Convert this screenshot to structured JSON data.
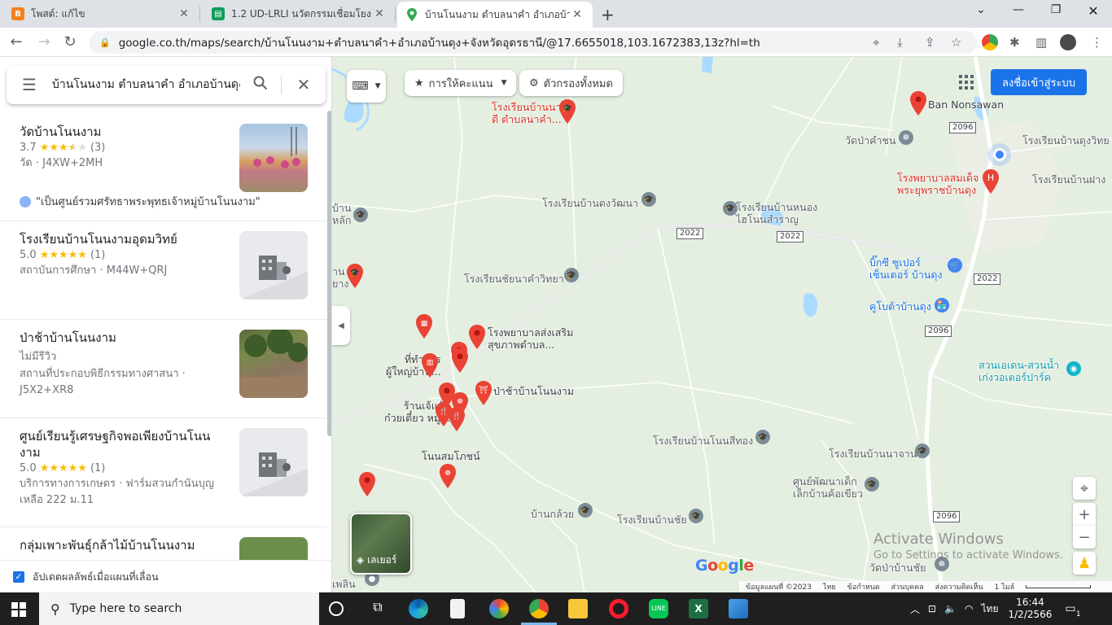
{
  "browser": {
    "tabs": [
      {
        "title": "โพสต์: แก้ไข",
        "favicon_color": "#f4801f",
        "active": false
      },
      {
        "title": "1.2 UD-LRLI นวัตกรรมเชื่อมโยงแหล่ง",
        "favicon_color": "#0f9d58",
        "active": false
      },
      {
        "title": "บ้านโนนงาม ตำบลนาคำ อำเภอบ้านดุง",
        "favicon_color": "#34a853",
        "active": true
      }
    ],
    "url": "google.co.th/maps/search/บ้านโนนงาม+ตำบลนาคำ+อำเภอบ้านดุง+จังหวัดอุดรธานี/@17.6655018,103.1672383,13z?hl=th"
  },
  "search": {
    "query": "บ้านโนนงาม ตำบลนาคำ อำเภอบ้านดุง"
  },
  "results": [
    {
      "name": "วัดบ้านโนนงาม",
      "score": "3.7",
      "stars_full": 3,
      "stars_half": 1,
      "stars_empty": 1,
      "count": "(3)",
      "meta": "วัด · J4XW+2MH",
      "review": "\"เป็นศูนย์รวมศรัทธาพระพุทธเจ้าหมู่บ้านโนนงาม\""
    },
    {
      "name": "โรงเรียนบ้านโนนงามอุดมวิทย์",
      "score": "5.0",
      "stars_full": 5,
      "stars_half": 0,
      "stars_empty": 0,
      "count": "(1)",
      "meta": "สถาบันการศึกษา · M44W+QRJ"
    },
    {
      "name": "ป่าช้าบ้านโนนงาม",
      "no_review": "ไม่มีรีวิว",
      "meta": "สถานที่ประกอบพิธีกรรมทางศาสนา · J5X2+XR8"
    },
    {
      "name": "ศูนย์เรียนรู้เศรษฐกิจพอเพียงบ้านโนนงาม",
      "score": "5.0",
      "stars_full": 5,
      "stars_half": 0,
      "stars_empty": 0,
      "count": "(1)",
      "meta": "บริการทางการเกษตร · ฟาร์มสวนกำนันบุญเหลือ 222 ม.11"
    },
    {
      "name": "กลุ่มเพาะพันธุ์กล้าไม้บ้านโนนงาม"
    }
  ],
  "update_checkbox": "อัปเดตผลลัพธ์เมื่อแผนที่เลื่อน",
  "map": {
    "rank_button": "การให้คะแนน",
    "filter_button": "ตัวกรองทั้งหมด",
    "signin": "ลงชื่อเข้าสู่ระบบ",
    "layers_label": "เลเยอร์",
    "labels": {
      "school_top": "โรงเรียนบ้านนา\nดี ตำบลนาคำ...",
      "ban_nonsawan": "Ban Nonsawan",
      "wat_pakamchon": "วัดป่าคำชน",
      "school_dungwit": "โรงเรียนบ้านดุงวิทย",
      "hospital": "โรงพยาบาลสมเด็จ\nพระยุพราชบ้านดุง",
      "school_fang": "โรงเรียนบ้านฝาง",
      "school_dungwattana": "โรงเรียนบ้านดงวัฒนา",
      "school_nongsamran": "โรงเรียนบ้านหนอง\nไฮโนนสำราญ",
      "bigc": "บิ๊กซี ซูเปอร์\nเซ็นเตอร์ บ้านดุง",
      "school_chainakham": "โรงเรียนชัยนาคำวิทยา",
      "kubuta": "คูโบต้าบ้านดุง",
      "hospital_promote": "โรงพยาบาลส่งเสริม\nสุขภาพตำบล...",
      "office": "ที่ทำการ\nผู้ใหญ่บ้าน...",
      "pacha": "ป่าช้าบ้านโนนงาม",
      "shop": "ร้านเจ้แห้ว\nก๋วยเตี๋ยว หมู...",
      "waterpark": "สวนเอเดน-สวนน้ำ\nเก่งวอเตอร์ปาร์ค",
      "school_nonsithong": "โรงเรียนบ้านโนนสีทอง",
      "school_nachan": "โรงเรียนบ้านนาจาน",
      "nonsomboon": "โนนสมโภชน์",
      "childcenter": "ศูนย์พัฒนาเด็ก\nเล็กบ้านค้อเขียว",
      "bankloy": "บ้านกล้วย",
      "school_banchai": "โรงเรียนบ้านชัย",
      "wat_pabanchai": "วัดป่าบ้านชัย",
      "banlak": "บ้าน\nหลัก",
      "banyang": "าน\nยาง",
      "phoem": "เพลิน"
    },
    "roads": [
      "2022",
      "2022",
      "2022",
      "2096",
      "2096",
      "2096"
    ],
    "google": "Google",
    "activate_line1": "Activate Windows",
    "activate_line2": "Go to Settings to activate Windows.",
    "footer": [
      "ข้อมูลแผนที่ ©2023",
      "ไทย",
      "ข้อกำหนด",
      "ส่วนบุคคล",
      "ส่งความคิดเห็น",
      "1 ไมล์"
    ]
  },
  "taskbar": {
    "search_placeholder": "Type here to search",
    "time": "16:44",
    "date": "1/2/2566",
    "lang": "ไทย",
    "notif_count": "1"
  }
}
